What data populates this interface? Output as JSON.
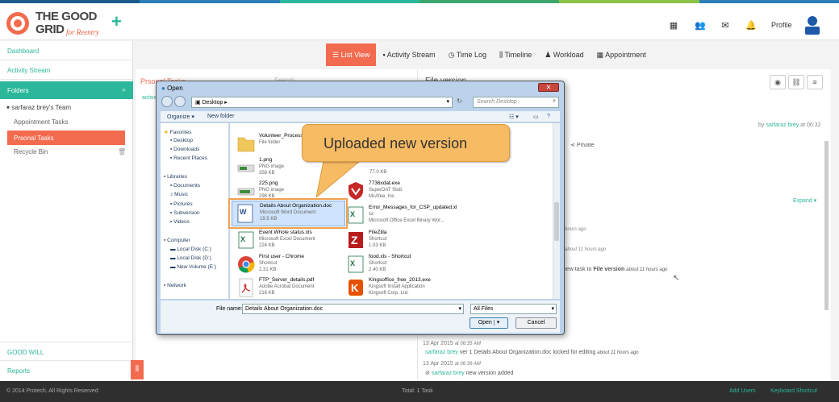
{
  "colors": {
    "accent": "#2bb79a",
    "orange": "#f26b4f",
    "stripe": [
      "#1e5a8a",
      "#2c7fb8",
      "#2bb79a",
      "#5cb85c",
      "#8bc34a",
      "#2c7fb8"
    ]
  },
  "logo": {
    "line1": "THE GOOD",
    "line2": "GRID",
    "sub": "for Reentry"
  },
  "header": {
    "profile": "Profile",
    "icons": [
      "apps-icon",
      "users-icon",
      "mail-icon",
      "bell-icon"
    ]
  },
  "sidebar": {
    "dashboard": "Dashboard",
    "activity": "Activity Stream",
    "folders": "Folders",
    "team": "▾ sarfaraz brey's Team",
    "appointment_tasks": "Appointment Tasks",
    "personal_tasks": "Prsonal Tasks",
    "recycle": "Recycle Bin",
    "good_will": "GOOD WILL",
    "reports": "Reports"
  },
  "tabs": [
    {
      "label": "List View"
    },
    {
      "label": "Activity Stream"
    },
    {
      "label": "Time Log"
    },
    {
      "label": "Timeline"
    },
    {
      "label": "Workload"
    },
    {
      "label": "Appointment"
    }
  ],
  "bg": {
    "panel_title": "Prsonal Tasks",
    "search": "Search",
    "file_version": "File version",
    "by": "by",
    "user": "sarfaraz brey",
    "at": "at 06:32",
    "private": "Private",
    "expand": "Expand",
    "active": "active",
    "ago1": "hours ago",
    "ago2": "about 11 hours ago",
    "task_to": "new task to",
    "file_version_link": "File version",
    "about11": "about 11 hours ago",
    "date1": "13 Apr 2015",
    "time1": "at 06:35 AM",
    "log1_user": "sarfaraz brey",
    "log1_text": "ver 1 Details About Organization.doc locked for editing",
    "log1_time": "about 11 hours ago",
    "date2": "13 Apr 2015",
    "time2": "at 06:39 AM",
    "log2_user": "sarfaraz brey",
    "log2_text": "new version added"
  },
  "footer": {
    "copyright": "© 2014 Protech, All Rights Reserved",
    "total": "Total: 1 Task",
    "add_users": "Add Users",
    "shortcut": "Keyboard Shortcut"
  },
  "dialog": {
    "title": "Open",
    "path": "Desktop",
    "search_placeholder": "Search Desktop",
    "organize": "Organize ▾",
    "new_folder": "New folder",
    "nav": [
      "Favorites",
      "Desktop",
      "Downloads",
      "Recent Places",
      "Libraries",
      "Documents",
      "Music",
      "Pictures",
      "Subversion",
      "Videos",
      "Computer",
      "Local Disk (C:)",
      "Local Disk (D:)",
      "New Volume (E:)",
      "Network"
    ],
    "files": [
      {
        "name": "Volunteer_Process",
        "t1": "File folder",
        "t2": ""
      },
      {
        "name": "1.png",
        "t1": "PNG image",
        "t2": "358 KB"
      },
      {
        "name": "225.png",
        "t1": "PNG image",
        "t2": "298 KB"
      },
      {
        "name": "Details About Organization.doc",
        "t1": "Microsoft Word Document",
        "t2": "19.5 KB"
      },
      {
        "name": "Event Whole status.xls",
        "t1": "Microsoft Excel Document",
        "t2": "224 KB"
      },
      {
        "name": "First user - Chrome",
        "t1": "Shortcut",
        "t2": "2.31 KB"
      },
      {
        "name": "FTP_Server_details.pdf",
        "t1": "Adobe Acrobat Document",
        "t2": "216 KB"
      },
      {
        "name": "",
        "t1": "",
        "t2": "77.0 KB"
      },
      {
        "name": "7736xdat.exe",
        "t1": "SuperDAT Stub",
        "t2": "McAfee, Inc."
      },
      {
        "name": "Error_Messages_for_CSP_updated.xl",
        "t1": "sx",
        "t2": "Microsoft Office Excel Binary Wor..."
      },
      {
        "name": "FileZilla",
        "t1": "Shortcut",
        "t2": "1.03 KB"
      },
      {
        "name": "food.xls - Shortcut",
        "t1": "Shortcut",
        "t2": "2.40 KB"
      },
      {
        "name": "Kingsoffice_free_2013.exe",
        "t1": "Kingsoft Install Application",
        "t2": "Kingsoft Corp. Ltd."
      }
    ],
    "filename_label": "File name:",
    "filename": "Details About Organization.doc",
    "filter": "All Files",
    "open": "Open",
    "cancel": "Cancel"
  },
  "callout": "Uploaded new version"
}
